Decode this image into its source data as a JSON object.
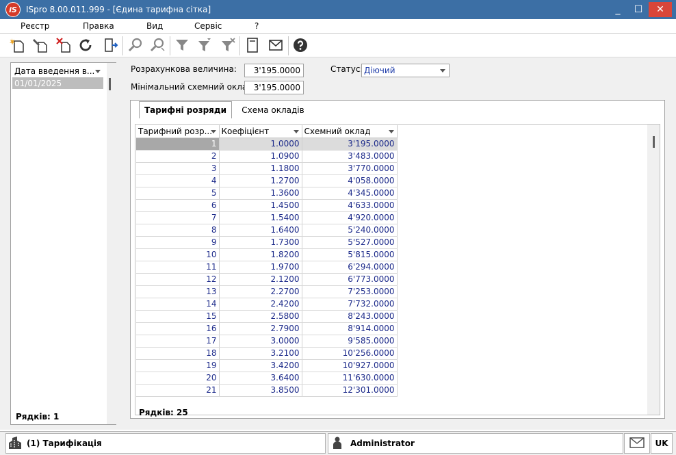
{
  "window": {
    "logo": "iS",
    "title": "ISpro 8.00.011.999 - [Єдина тарифна сітка]",
    "minimize": "_",
    "maximize": "☐",
    "close": "✕"
  },
  "menu": [
    "Реєстр",
    "Правка",
    "Вид",
    "Сервіс",
    "?"
  ],
  "toolbar_icons": [
    "new-icon",
    "edit-icon",
    "delete-icon",
    "refresh-icon",
    "exit-icon",
    "find-icon",
    "find-next-icon",
    "filter-icon",
    "filter-set-icon",
    "filter-clear-icon",
    "document-icon",
    "mail-icon",
    "help-icon"
  ],
  "left_list": {
    "header": "Дата введення в...",
    "rows": [
      "01/01/2025"
    ],
    "count_label": "Рядків: 1"
  },
  "form": {
    "calc_value_label": "Розрахункова величина:",
    "calc_value": "3'195.0000",
    "min_salary_label": "Мінімальний схемний оклад:",
    "min_salary": "3'195.0000",
    "status_label": "Статус:",
    "status_value": "Діючий"
  },
  "tabs": [
    "Тарифні розряди",
    "Схема окладів"
  ],
  "grid": {
    "columns": [
      "Тарифний розр...",
      "Коефіцієнт",
      "Схемний оклад"
    ],
    "rows": [
      [
        "1",
        "1.0000",
        "3'195.0000"
      ],
      [
        "2",
        "1.0900",
        "3'483.0000"
      ],
      [
        "3",
        "1.1800",
        "3'770.0000"
      ],
      [
        "4",
        "1.2700",
        "4'058.0000"
      ],
      [
        "5",
        "1.3600",
        "4'345.0000"
      ],
      [
        "6",
        "1.4500",
        "4'633.0000"
      ],
      [
        "7",
        "1.5400",
        "4'920.0000"
      ],
      [
        "8",
        "1.6400",
        "5'240.0000"
      ],
      [
        "9",
        "1.7300",
        "5'527.0000"
      ],
      [
        "10",
        "1.8200",
        "5'815.0000"
      ],
      [
        "11",
        "1.9700",
        "6'294.0000"
      ],
      [
        "12",
        "2.1200",
        "6'773.0000"
      ],
      [
        "13",
        "2.2700",
        "7'253.0000"
      ],
      [
        "14",
        "2.4200",
        "7'732.0000"
      ],
      [
        "15",
        "2.5800",
        "8'243.0000"
      ],
      [
        "16",
        "2.7900",
        "8'914.0000"
      ],
      [
        "17",
        "3.0000",
        "9'585.0000"
      ],
      [
        "18",
        "3.2100",
        "10'256.0000"
      ],
      [
        "19",
        "3.4200",
        "10'927.0000"
      ],
      [
        "20",
        "3.6400",
        "11'630.0000"
      ],
      [
        "21",
        "3.8500",
        "12'301.0000"
      ]
    ],
    "count_label": "Рядків: 25"
  },
  "statusbar": {
    "module": "(1) Тарифікація",
    "user": "Administrator",
    "lang": "UK"
  }
}
